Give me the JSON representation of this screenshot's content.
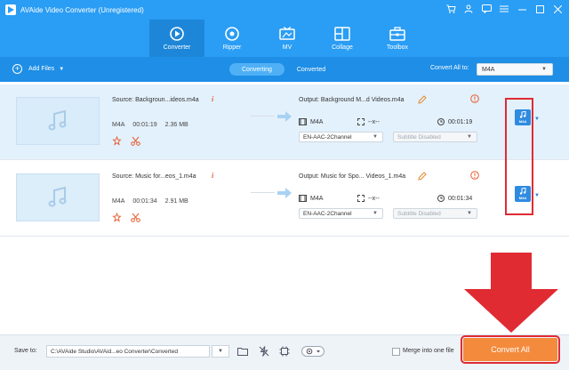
{
  "window": {
    "title": "AVAide Video Converter (Unregistered)"
  },
  "nav": {
    "tabs": [
      {
        "label": "Converter",
        "icon": "converter-icon",
        "active": true
      },
      {
        "label": "Ripper",
        "icon": "ripper-icon"
      },
      {
        "label": "MV",
        "icon": "mv-icon"
      },
      {
        "label": "Collage",
        "icon": "collage-icon"
      },
      {
        "label": "Toolbox",
        "icon": "toolbox-icon"
      }
    ]
  },
  "toolbar": {
    "add_files": "Add Files",
    "segments": [
      "Converting",
      "Converted"
    ],
    "convert_all_to_label": "Convert All to:",
    "convert_all_to_value": "M4A"
  },
  "files": [
    {
      "source": "Source: Backgroun...ideos.m4a",
      "format": "M4A",
      "duration": "00:01:19",
      "size": "2.36 MB",
      "output": "Output: Background M...d Videos.m4a",
      "out_format": "M4A",
      "out_resolution": "--x--",
      "out_duration": "00:01:19",
      "audio_track": "EN-AAC-2Channel",
      "subtitle": "Subtitle Disabled",
      "badge": "M4A"
    },
    {
      "source": "Source: Music for...eos_1.m4a",
      "format": "M4A",
      "duration": "00:01:34",
      "size": "2.91 MB",
      "output": "Output: Music for Spo... Videos_1.m4a",
      "out_format": "M4A",
      "out_resolution": "--x--",
      "out_duration": "00:01:34",
      "audio_track": "EN-AAC-2Channel",
      "subtitle": "Subtitle Disabled",
      "badge": "M4A"
    }
  ],
  "bottom": {
    "save_to_label": "Save to:",
    "save_path": "C:\\AVAide Studio\\AVAid...eo Converter\\Converted",
    "merge_label": "Merge into one file",
    "convert_all": "Convert All"
  },
  "colors": {
    "header_blue": "#2a9df4",
    "toolbar_blue": "#1e8ee6",
    "accent_orange": "#f48a3c",
    "annotation_red": "#e02b33"
  }
}
